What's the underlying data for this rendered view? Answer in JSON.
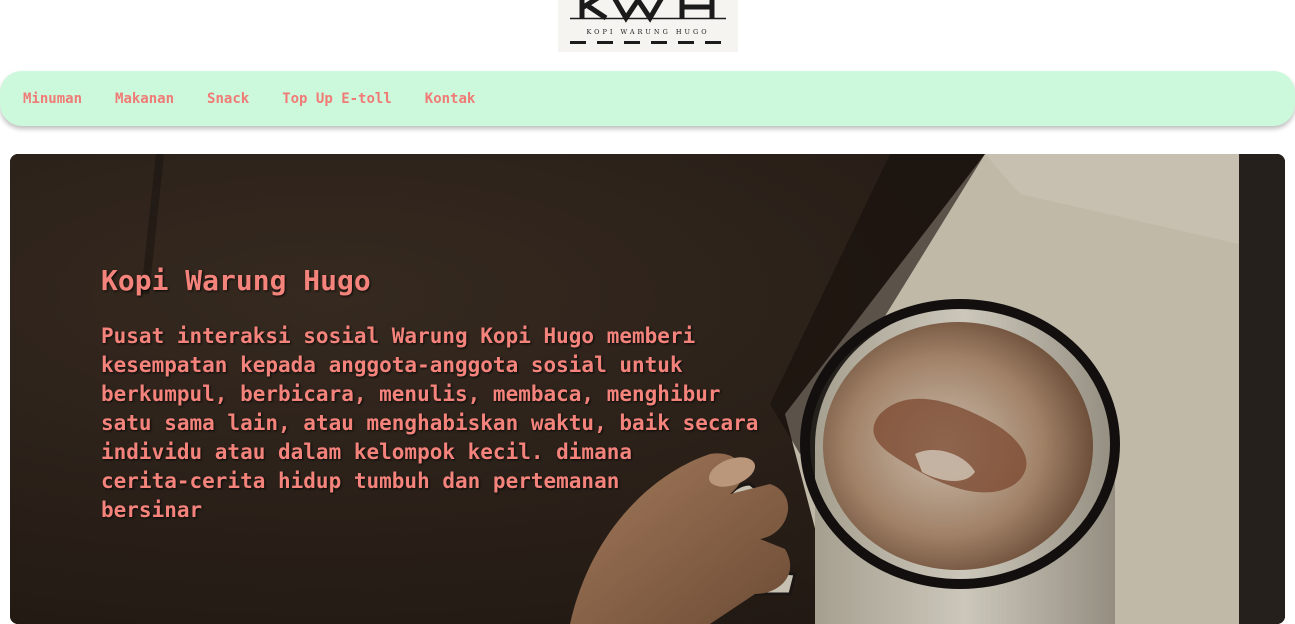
{
  "logo": {
    "mark": "KWH",
    "subtitle": "KOPI WARUNG HUGO"
  },
  "nav": {
    "items": [
      {
        "label": "Minuman"
      },
      {
        "label": "Makanan"
      },
      {
        "label": "Snack"
      },
      {
        "label": "Top Up E-toll"
      },
      {
        "label": "Kontak"
      }
    ]
  },
  "hero": {
    "title": "Kopi Warung Hugo",
    "description": "Pusat interaksi sosial Warung Kopi Hugo memberi\nkesempatan kepada anggota-anggota sosial untuk\nberkumpul, berbicara, menulis, membaca, menghibur\nsatu sama lain, atau menghabiskan waktu, baik secara\nindividu atau dalam kelompok kecil. dimana\ncerita-cerita hidup tumbuh dan pertemanan\nbersinar"
  },
  "colors": {
    "nav_background": "#ccf8dc",
    "accent_text": "#f4837c",
    "hero_background": "#2f241d"
  }
}
